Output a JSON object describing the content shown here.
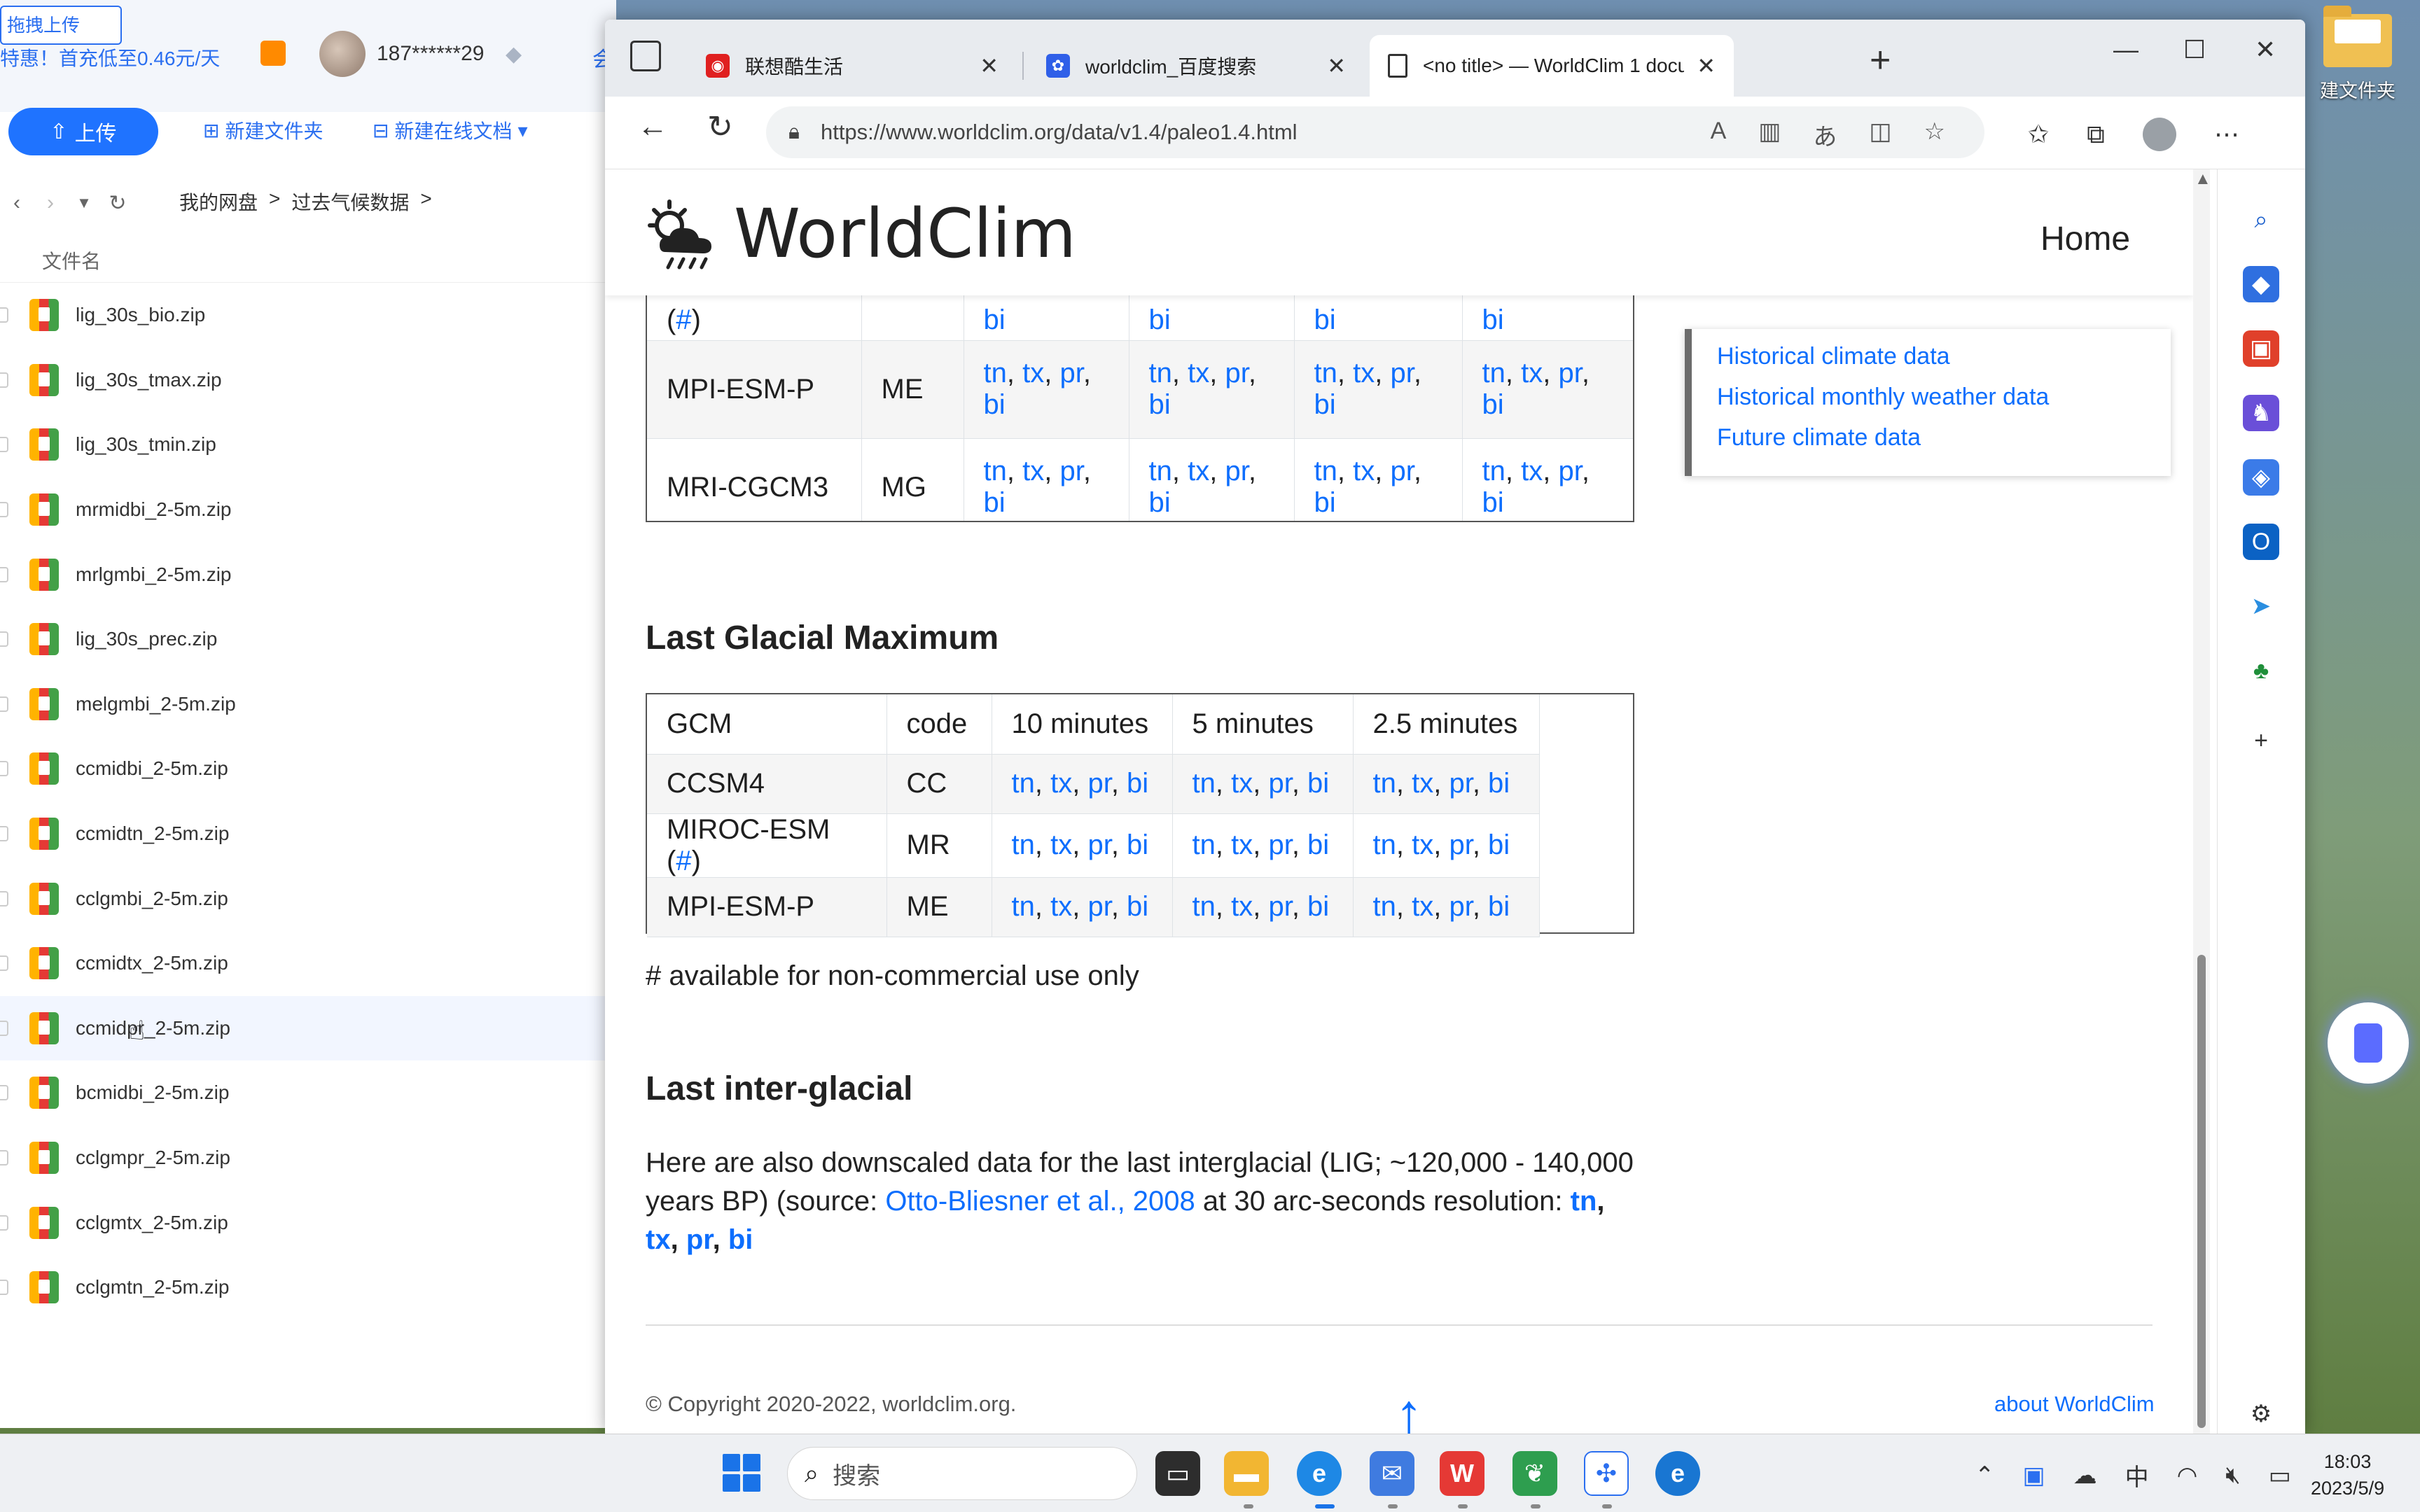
{
  "desktop": {
    "folder_label": "建文件夹"
  },
  "netdisk": {
    "upload_hint": "拖拽上传",
    "promo": "特惠！首充低至0.46元/天",
    "username": "187******29",
    "extra": "会",
    "upload_button": "上传",
    "new_folder": "新建文件夹",
    "new_online_doc": "新建在线文档",
    "breadcrumb": [
      "我的网盘",
      ">",
      "过去气候数据",
      ">"
    ],
    "column_header": "文件名",
    "files": [
      "lig_30s_bio.zip",
      "lig_30s_tmax.zip",
      "lig_30s_tmin.zip",
      "mrmidbi_2-5m.zip",
      "mrlgmbi_2-5m.zip",
      "lig_30s_prec.zip",
      "melgmbi_2-5m.zip",
      "ccmidbi_2-5m.zip",
      "ccmidtn_2-5m.zip",
      "cclgmbi_2-5m.zip",
      "ccmidtx_2-5m.zip",
      "ccmidpr_2-5m.zip",
      "bcmidbi_2-5m.zip",
      "cclgmpr_2-5m.zip",
      "cclgmtx_2-5m.zip",
      "cclgmtn_2-5m.zip"
    ]
  },
  "browser": {
    "tabs": [
      {
        "title": "联想酷生活",
        "icon": "lenovo-icon"
      },
      {
        "title": "worldclim_百度搜索",
        "icon": "baidu-paw-icon"
      },
      {
        "title": "<no title> — WorldClim 1 documentation",
        "icon": "document-icon"
      }
    ],
    "url": "https://www.worldclim.org/data/v1.4/paleo1.4.html"
  },
  "page": {
    "logo_text": "WorldClim",
    "nav_home": "Home",
    "table1": {
      "rows": [
        {
          "gcm": "(#)",
          "gcm_hash": "#",
          "code": "",
          "partial": true
        },
        {
          "gcm": "MPI-ESM-P",
          "code": "ME"
        },
        {
          "gcm": "MRI-CGCM3",
          "code": "MG"
        }
      ],
      "links": [
        "tn",
        "tx",
        "pr",
        "bi"
      ]
    },
    "lgm": {
      "heading": "Last Glacial Maximum",
      "header": [
        "GCM",
        "code",
        "10 minutes",
        "5 minutes",
        "2.5 minutes"
      ],
      "rows": [
        {
          "gcm": "CCSM4",
          "code": "CC"
        },
        {
          "gcm": "MIROC-ESM (#)",
          "code": "MR"
        },
        {
          "gcm": "MPI-ESM-P",
          "code": "ME"
        }
      ],
      "links": [
        "tn",
        "tx",
        "pr",
        "bi"
      ]
    },
    "note": "# available for non-commercial use only",
    "lig": {
      "heading": "Last inter-glacial",
      "text_1": "Here are also downscaled data for the last interglacial (LIG; ~120,000 - 140,000 years BP) (source: ",
      "source_link": "Otto-Bliesner et al., 2008",
      "text_2": " at 30 arc-seconds resolution: ",
      "links": [
        "tn",
        "tx",
        "pr",
        "bi"
      ]
    },
    "sidebar_links": [
      "Historical climate data",
      "Historical monthly weather data",
      "Future climate data"
    ],
    "copyright": "© Copyright 2020-2022, worldclim.org.",
    "about": "about WorldClim"
  },
  "taskbar": {
    "search_placeholder": "搜索",
    "ime": "中",
    "time": "18:03",
    "date": "2023/5/9"
  }
}
